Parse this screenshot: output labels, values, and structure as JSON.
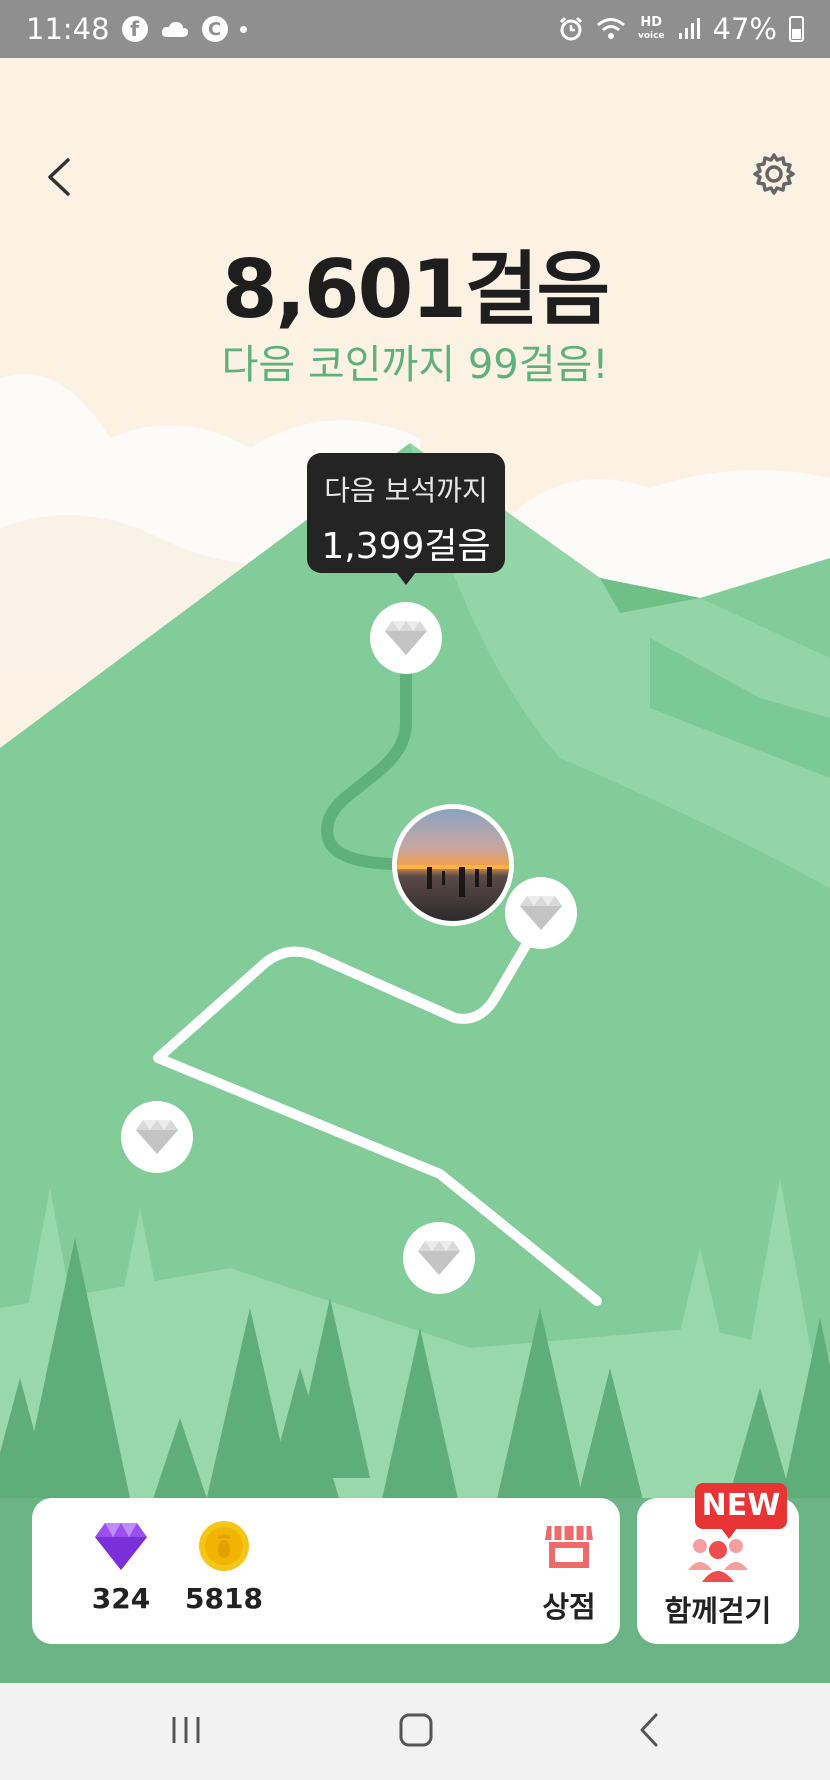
{
  "status_bar": {
    "time": "11:48",
    "battery_percent": "47%",
    "hd_line1": "HD",
    "hd_line2": "voice",
    "left_icons": [
      "facebook-icon",
      "cloud-icon",
      "c-icon",
      "dot-icon"
    ],
    "right_icons": [
      "alarm-icon",
      "wifi-icon",
      "hd-voice-icon",
      "signal-icon",
      "battery-icon"
    ]
  },
  "header": {
    "steps": "8,601걸음",
    "next_coin": "다음 코인까지 99걸음!"
  },
  "tooltip": {
    "line1": "다음 보석까지",
    "line2": "1,399걸음"
  },
  "stats": {
    "gems": "324",
    "coins": "5818",
    "shop_label": "상점"
  },
  "together": {
    "label": "함께걷기",
    "badge": "NEW"
  },
  "colors": {
    "background": "#f6efe2",
    "mountain": "#82cc99",
    "accent_green": "#5fb07a",
    "badge_red": "#e83434",
    "gem_purple": "#a855f7",
    "coin_yellow": "#f5c518"
  }
}
